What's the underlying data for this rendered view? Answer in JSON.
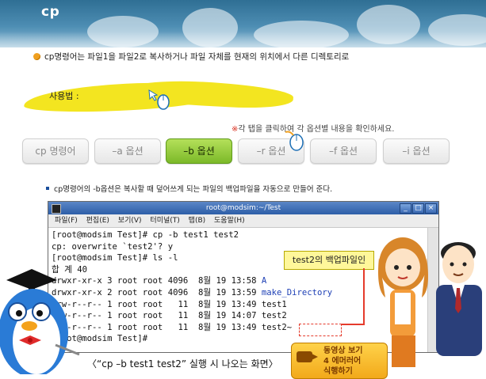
{
  "header": {
    "title": "cp"
  },
  "intro": {
    "text": "cp명령어는 파일1을 파일2로 복사하거나 파일 자체를 현재의 위치에서 다른 디렉토리로"
  },
  "usage": {
    "label": "사용법 :"
  },
  "hint": {
    "mark": "※",
    "text": "각 탭을 클릭하여 각 옵션별 내용을 확인하세요."
  },
  "tabs": [
    {
      "label": "cp 명령어",
      "active": false
    },
    {
      "label": "–a 옵션",
      "active": false
    },
    {
      "label": "–b 옵션",
      "active": true
    },
    {
      "label": "–r 옵션",
      "active": false
    },
    {
      "label": "–f 옵션",
      "active": false
    },
    {
      "label": "–i 옵션",
      "active": false
    }
  ],
  "explanation": {
    "text": "cp명령어의 -b옵션은 복사할 때 덮어쓰게 되는 파일의 백업파일을 자동으로 만들어 준다."
  },
  "terminal": {
    "title": "root@modsim:~/Test",
    "menu": [
      "파일(F)",
      "편집(E)",
      "보기(V)",
      "터미널(T)",
      "탭(B)",
      "도움말(H)"
    ],
    "lines": [
      "[root@modsim Test]# cp -b test1 test2",
      "cp: overwrite `test2'? y",
      "[root@modsim Test]# ls -l",
      "합 계 40",
      "drwxr-xr-x 3 root root 4096  8월 19 13:58 ",
      "drwxr-xr-x 2 root root 4096  8월 19 13:59 ",
      "-rw-r--r-- 1 root root   11  8월 19 13:49 test1",
      "-rw-r--r-- 1 root root   11  8월 19 14:07 test2",
      "-rw-r--r-- 1 root root   11  8월 19 13:49 test2~",
      "[root@modsim Test]#"
    ],
    "dir_names": [
      "A",
      "make_Directory"
    ]
  },
  "callout": {
    "text": "test2의 백업파일인"
  },
  "caption": {
    "text": "〈“cp –b test1 test2” 실행 시 나오는 화면〉"
  },
  "video_button": {
    "line1": "동영상 보기",
    "line2": "4 에머러어",
    "line3": "식행하기"
  },
  "colors": {
    "active_tab": "#7cb929",
    "accent_yellow": "#f3e520",
    "callout_red": "#e53b2c",
    "header_blue": "#2f6f94"
  }
}
